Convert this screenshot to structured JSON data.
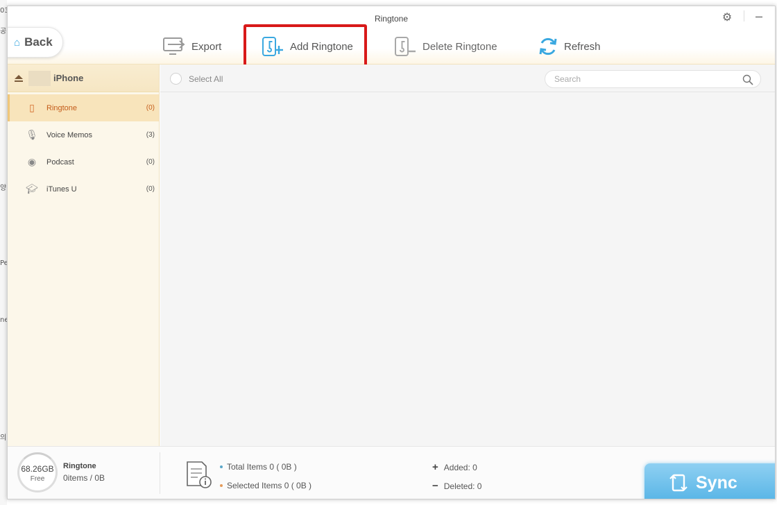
{
  "window": {
    "title": "Ringtone"
  },
  "back": {
    "label": "Back"
  },
  "toolbar": {
    "export_label": "Export",
    "add_label": "Add Ringtone",
    "delete_label": "Delete Ringtone",
    "refresh_label": "Refresh"
  },
  "device": {
    "name": "iPhone"
  },
  "sidebar": {
    "items": [
      {
        "label": "Ringtone",
        "count": "(0)",
        "icon": "ringtone-icon",
        "active": true
      },
      {
        "label": "Voice Memos",
        "count": "(3)",
        "icon": "microphone-icon"
      },
      {
        "label": "Podcast",
        "count": "(0)",
        "icon": "podcast-icon"
      },
      {
        "label": "iTunes U",
        "count": "(0)",
        "icon": "itunes-u-icon"
      }
    ]
  },
  "list": {
    "select_all_label": "Select All",
    "search_placeholder": "Search"
  },
  "footer": {
    "storage_value": "68.26GB",
    "storage_label": "Free",
    "category_name": "Ringtone",
    "category_summary": "0items / 0B",
    "total_items": "Total Items 0 ( 0B )",
    "selected_items": "Selected Items 0 ( 0B )",
    "added": "Added: 0",
    "deleted": "Deleted: 0",
    "sync_label": "Sync"
  },
  "colors": {
    "highlight_box": "#d81919",
    "accent_blue": "#3aa8e0",
    "active_item_text": "#c45c1a",
    "sync_button": "#56b4e6"
  }
}
